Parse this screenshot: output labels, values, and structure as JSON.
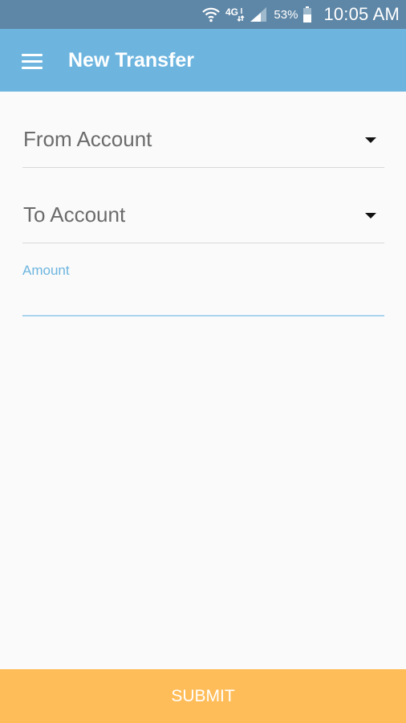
{
  "status_bar": {
    "network": "4G",
    "battery": "53%",
    "time": "10:05 AM",
    "icons": [
      "wifi-icon",
      "network-4g-icon",
      "signal-icon",
      "battery-icon"
    ]
  },
  "app_bar": {
    "title": "New Transfer",
    "menu_icon": "menu-icon",
    "background_color": "#6db5df"
  },
  "form": {
    "from_account": {
      "label": "From Account",
      "icon": "chevron-down-icon"
    },
    "to_account": {
      "label": "To Account",
      "icon": "chevron-down-icon"
    },
    "amount": {
      "label": "Amount",
      "value": "",
      "accent_color": "#6db5df"
    }
  },
  "submit": {
    "label": "SUBMIT",
    "color": "#ffbd5a"
  }
}
